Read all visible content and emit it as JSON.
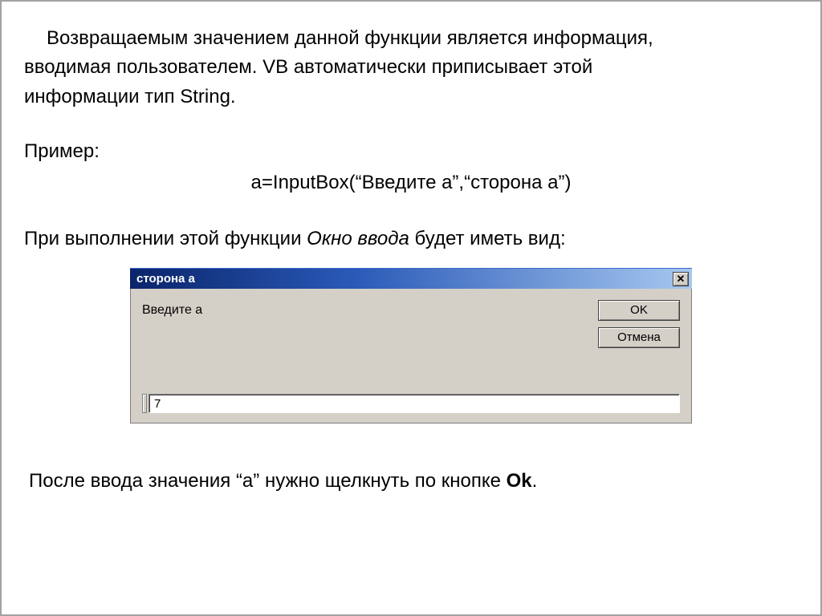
{
  "doc": {
    "p1a": "Возвращаемым значением данной функции является информация,",
    "p1b": "вводимая пользователем. VB автоматически приписывает этой",
    "p1c": "информации тип String.",
    "example_label": "Пример:",
    "code": "a=InputBox(“Введите а”,“сторона а”)",
    "p2a": "При выполнении этой функции ",
    "p2_italic": "Окно ввода",
    "p2b": " будет иметь вид:",
    "p3a": "После ввода значения “а” нужно щелкнуть по кнопке ",
    "p3_bold": "Ok",
    "p3b": "."
  },
  "dialog": {
    "title": "сторона а",
    "close": "✕",
    "prompt": "Введите а",
    "ok": "OK",
    "cancel": "Отмена",
    "value": "7"
  }
}
